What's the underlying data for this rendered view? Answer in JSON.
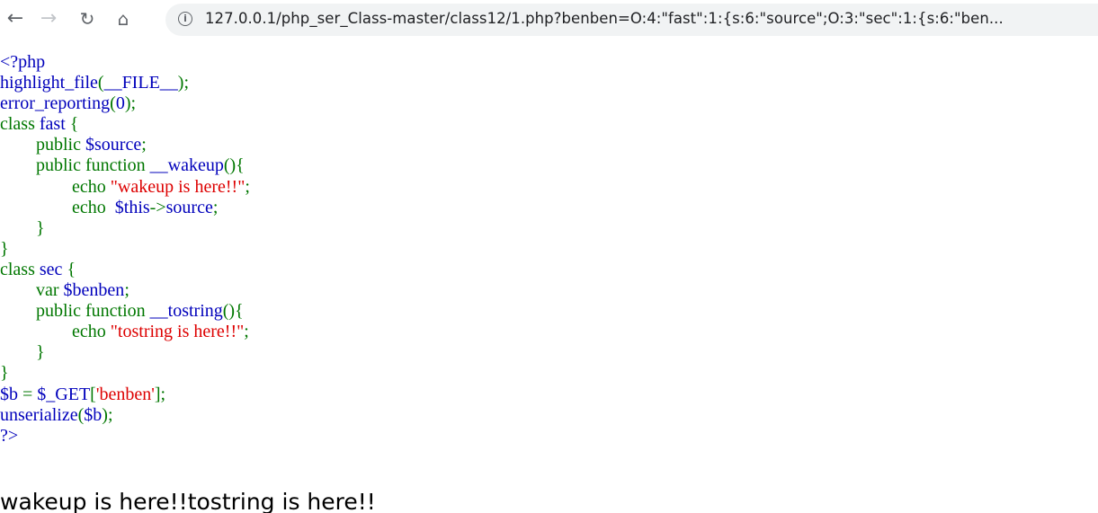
{
  "browser": {
    "url": "127.0.0.1/php_ser_Class-master/class12/1.php?benben=O:4:\"fast\":1:{s:6:\"source\";O:3:\"sec\":1:{s:6:\"ben...",
    "icons": {
      "back": "arrow-left",
      "forward": "arrow-right",
      "reload": "reload",
      "home": "home",
      "site_info": "info"
    }
  },
  "code": {
    "colors": {
      "default": "#0000BB",
      "keyword": "#007700",
      "string": "#DD0000"
    },
    "tokens": {
      "t1": "<?php",
      "t2": "highlight_file",
      "t3": "(",
      "t4": "__FILE__",
      "t5": ");",
      "t6": "error_reporting",
      "t7": "(",
      "t8": "0",
      "t9": ");",
      "t10": "class ",
      "t11": "fast ",
      "t12": "{",
      "t13": "public ",
      "t14": "$source",
      "t15": ";",
      "t16": "public function ",
      "t17": "__wakeup",
      "t18": "(){",
      "t19": "echo ",
      "t20": "\"wakeup is here!!\"",
      "t21": ";",
      "t22": "echo  ",
      "t23": "$this",
      "t24": "->",
      "t25": "source",
      "t26": ";",
      "t27": "}",
      "t28": "}",
      "t29": "class ",
      "t30": "sec ",
      "t31": "{",
      "t32": "var ",
      "t33": "$benben",
      "t34": ";",
      "t35": "public function ",
      "t36": "__tostring",
      "t37": "(){",
      "t38": "echo ",
      "t39": "\"tostring is here!!\"",
      "t40": ";",
      "t41": "}",
      "t42": "}",
      "t43": "$b ",
      "t44": "= ",
      "t45": "$_GET",
      "t46": "[",
      "t47": "'benben'",
      "t48": "];",
      "t49": "unserialize",
      "t50": "(",
      "t51": "$b",
      "t52": ");",
      "t53": "?>"
    }
  },
  "output": {
    "text": "wakeup is here!!tostring is here!!"
  }
}
